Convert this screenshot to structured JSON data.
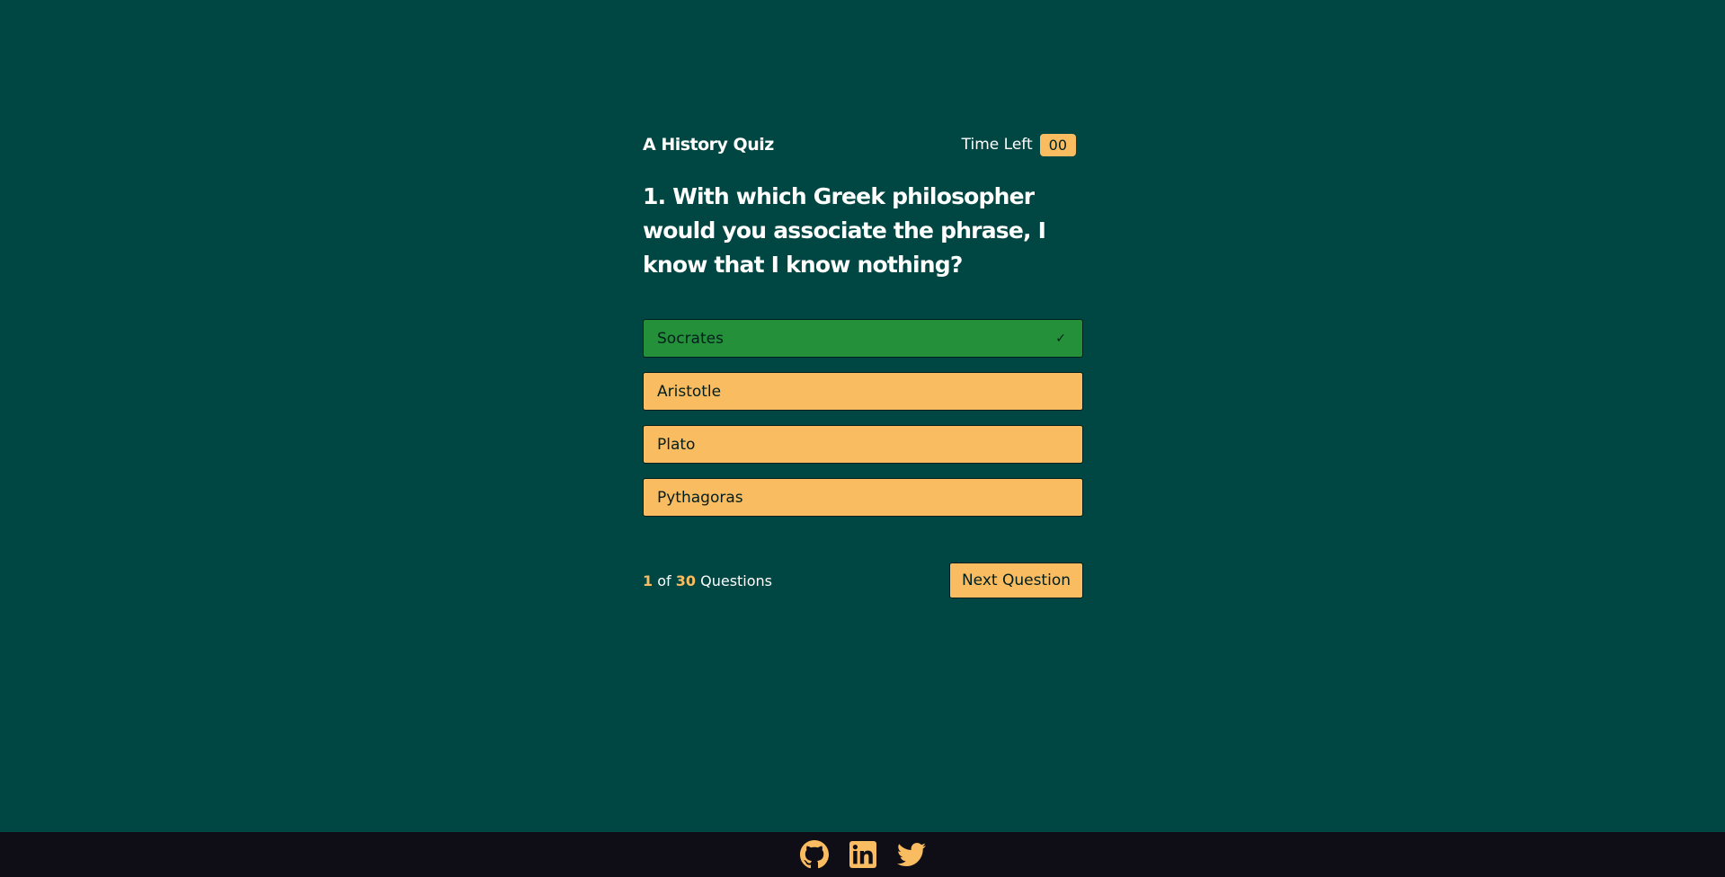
{
  "header": {
    "title": "A History Quiz",
    "timer_label": "Time Left",
    "timer_value": "00"
  },
  "question": {
    "text": "1. With which Greek philosopher would you associate the phrase, I know that I know nothing?",
    "options": [
      {
        "label": "Socrates",
        "state": "correct",
        "icon": "check-icon"
      },
      {
        "label": "Aristotle",
        "state": "default"
      },
      {
        "label": "Plato",
        "state": "default"
      },
      {
        "label": "Pythagoras",
        "state": "default"
      }
    ]
  },
  "progress": {
    "current": "1",
    "of": "of",
    "total": "30",
    "suffix": "Questions"
  },
  "next_button_label": "Next Question",
  "footer": {
    "icons": [
      "github-icon",
      "linkedin-icon",
      "twitter-icon"
    ]
  },
  "colors": {
    "background": "#004643",
    "accent": "#f9bc60",
    "correct": "#24913a",
    "footer": "#0f0e17"
  }
}
